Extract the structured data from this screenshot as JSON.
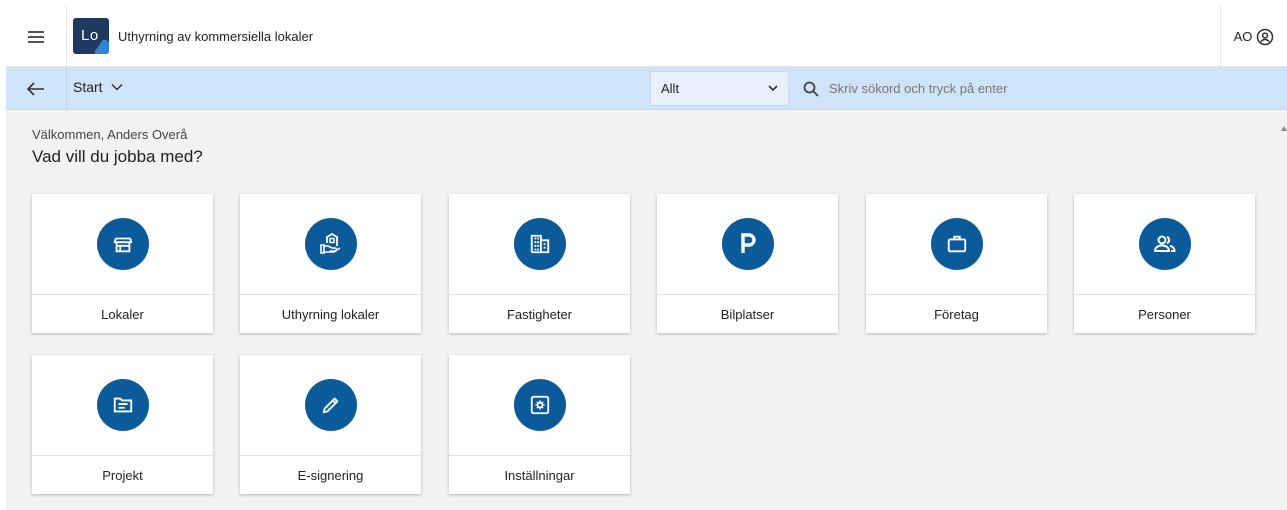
{
  "header": {
    "logo_text": "Lo",
    "app_title": "Uthyrning av kommersiella lokaler",
    "user_initials": "AO",
    "menu_icon": "hamburger-menu-icon",
    "account_icon": "account-circle-icon"
  },
  "subbar": {
    "back_icon": "arrow-left-icon",
    "nav_label": "Start",
    "scope_select": "Allt",
    "search_placeholder": "Skriv sökord och tryck på enter"
  },
  "content": {
    "welcome": "Välkommen, Anders Overå",
    "question": "Vad vill du jobba med?"
  },
  "tiles": [
    {
      "label": "Lokaler",
      "icon": "storefront-icon"
    },
    {
      "label": "Uthyrning lokaler",
      "icon": "rent-building-icon"
    },
    {
      "label": "Fastigheter",
      "icon": "building-icon"
    },
    {
      "label": "Bilplatser",
      "icon": "parking-icon"
    },
    {
      "label": "Företag",
      "icon": "briefcase-icon"
    },
    {
      "label": "Personer",
      "icon": "people-icon"
    },
    {
      "label": "Projekt",
      "icon": "folder-icon"
    },
    {
      "label": "E-signering",
      "icon": "pen-icon"
    },
    {
      "label": "Inställningar",
      "icon": "settings-icon"
    }
  ],
  "colors": {
    "accent": "#0b5b9a",
    "subbar": "#cfe3f9",
    "background": "#f2f2f2",
    "logo": "#1e3a5f"
  }
}
